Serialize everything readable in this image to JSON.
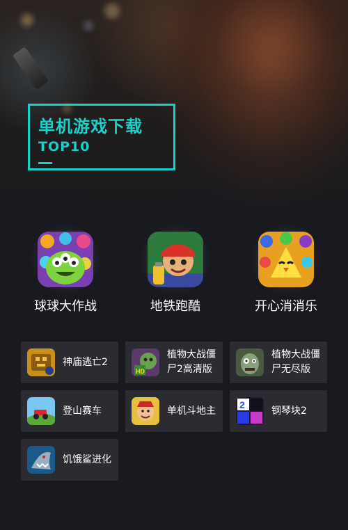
{
  "hero": {
    "title": "单机游戏下载",
    "subtitle": "TOP10",
    "accent_color": "#1ad1c9"
  },
  "top3": [
    {
      "name": "球球大作战",
      "icon": "green-monster-icon"
    },
    {
      "name": "地铁跑酷",
      "icon": "subway-surfer-icon"
    },
    {
      "name": "开心消消乐",
      "icon": "yellow-chick-icon"
    }
  ],
  "games": [
    {
      "name": "神庙逃亡2",
      "icon": "temple-run-icon"
    },
    {
      "name": "植物大战僵尸2高清版",
      "line1": "植物大战僵",
      "line2": "尸2高清版",
      "icon": "pvz2-icon"
    },
    {
      "name": "植物大战僵尸无尽版",
      "line1": "植物大战僵",
      "line2": "尸无尽版",
      "icon": "pvz-zombie-icon"
    },
    {
      "name": "登山赛车",
      "icon": "hill-climb-icon"
    },
    {
      "name": "单机斗地主",
      "icon": "landlord-icon"
    },
    {
      "name": "钢琴块2",
      "icon": "piano-tiles-icon"
    },
    {
      "name": "饥饿鲨进化",
      "icon": "hungry-shark-icon"
    }
  ]
}
